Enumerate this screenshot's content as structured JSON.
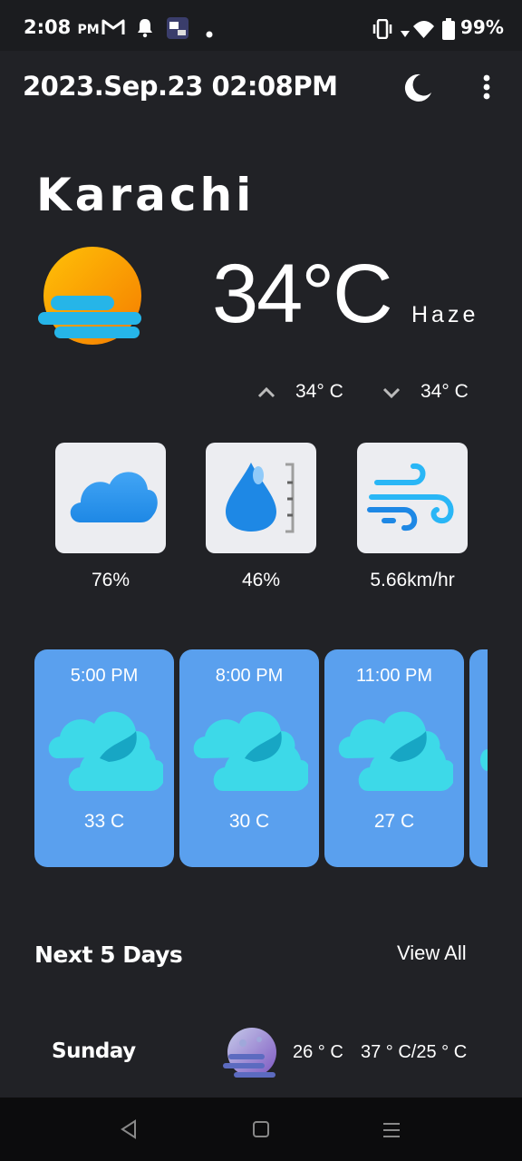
{
  "status_bar": {
    "time": "2:08",
    "ampm": "PM",
    "battery": "99%",
    "icons": [
      "gmail-icon",
      "notification-bell-icon",
      "app-icon",
      "dot-icon",
      "vibrate-icon",
      "wifi-icon",
      "battery-icon"
    ]
  },
  "header": {
    "datetime": "2023.Sep.23 02:08PM",
    "icons": [
      "moon-icon",
      "more-vert-icon"
    ]
  },
  "current": {
    "city": "Karachi",
    "temperature": "34°C",
    "condition": "Haze",
    "high": "34° C",
    "low": "34° C",
    "icon": "haze-sun-icon"
  },
  "stats": [
    {
      "icon": "cloud-icon",
      "value": "76%"
    },
    {
      "icon": "humidity-drop-icon",
      "value": "46%"
    },
    {
      "icon": "wind-icon",
      "value": "5.66km/hr"
    }
  ],
  "hourly": [
    {
      "time": "5:00 PM",
      "temp": "33 C",
      "icon": "cloudy-icon"
    },
    {
      "time": "8:00 PM",
      "temp": "30 C",
      "icon": "cloudy-icon"
    },
    {
      "time": "11:00 PM",
      "temp": "27 C",
      "icon": "cloudy-icon"
    }
  ],
  "next_days": {
    "title": "Next 5 Days",
    "view_all": "View All",
    "items": [
      {
        "day": "Sunday",
        "temp": "26 ° C",
        "range": "37 ° C/25 ° C",
        "icon": "night-haze-moon-icon"
      }
    ]
  },
  "colors": {
    "background": "#212226",
    "card_blue": "#5aa0ee",
    "tile_bg": "#ecedf1",
    "icon_blue": "#1e88e5",
    "cloud_cyan": "#3dd9e8"
  }
}
